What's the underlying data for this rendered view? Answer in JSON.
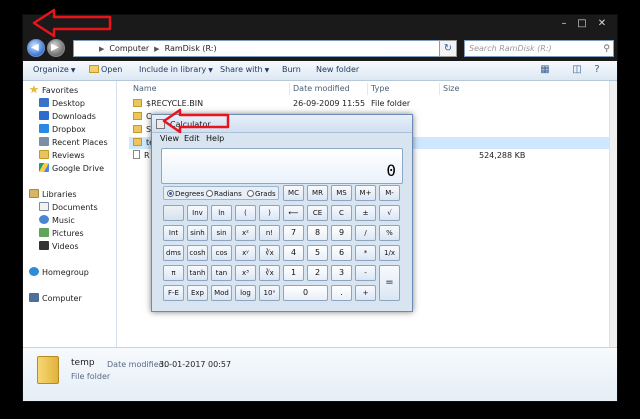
{
  "explorer": {
    "address_parts": [
      "Computer",
      "RamDisk (R:)"
    ],
    "search_placeholder": "Search RamDisk (R:)",
    "toolbar": {
      "organize": "Organize",
      "open": "Open",
      "include_in_library": "Include in library",
      "share_with": "Share with",
      "burn": "Burn",
      "new_folder": "New folder"
    },
    "nav": {
      "favorites": "Favorites",
      "favorites_items": [
        "Desktop",
        "Downloads",
        "Dropbox",
        "Recent Places",
        "Reviews",
        "Google Drive"
      ],
      "libraries": "Libraries",
      "libraries_items": [
        "Documents",
        "Music",
        "Pictures",
        "Videos"
      ],
      "homegroup": "Homegroup",
      "computer": "Computer"
    },
    "columns": {
      "name": "Name",
      "date_modified": "Date modified",
      "type": "Type",
      "size": "Size"
    },
    "rows": [
      {
        "name": "$RECYCLE.BIN",
        "date": "26-09-2009 11:55",
        "type": "File folder",
        "size": ""
      },
      {
        "name": "C",
        "date": "",
        "type": "",
        "size": ""
      },
      {
        "name": "S",
        "date": "",
        "type": "",
        "size": ""
      },
      {
        "name": "te",
        "date": "",
        "type": "",
        "size": ""
      },
      {
        "name": "R",
        "date": "",
        "type": "",
        "size": "524,288 KB"
      }
    ],
    "details": {
      "name": "temp",
      "modified_label": "Date modified:",
      "modified_value": "30-01-2017 00:57",
      "type": "File folder"
    }
  },
  "calculator": {
    "title": "Calculator",
    "menu": [
      "View",
      "Edit",
      "Help"
    ],
    "display": "0",
    "modes": [
      "Degrees",
      "Radians",
      "Grads"
    ],
    "selected_mode": "Degrees",
    "keys": {
      "mc": "MC",
      "mr": "MR",
      "ms": "MS",
      "mplus": "M+",
      "mminus": "M-",
      "inv": "Inv",
      "ln": "ln",
      "lparen": "(",
      "rparen": ")",
      "backspace": "⟵",
      "ce": "CE",
      "c": "C",
      "plusminus": "±",
      "sqrt": "√",
      "int": "Int",
      "sinh": "sinh",
      "sin": "sin",
      "xsq": "x²",
      "fact": "n!",
      "k7": "7",
      "k8": "8",
      "k9": "9",
      "div": "/",
      "pct": "%",
      "dms": "dms",
      "cosh": "cosh",
      "cos": "cos",
      "xy": "xʸ",
      "yroot": "∛x",
      "k4": "4",
      "k5": "5",
      "k6": "6",
      "mul": "*",
      "recip": "1/x",
      "pi": "π",
      "tanh": "tanh",
      "tan": "tan",
      "xcube": "x³",
      "cuberoot": "∛x",
      "k1": "1",
      "k2": "2",
      "k3": "3",
      "sub": "-",
      "eq": "=",
      "fe": "F-E",
      "exp": "Exp",
      "mod": "Mod",
      "log": "log",
      "tenx": "10ˣ",
      "k0": "0",
      "dot": ".",
      "add": "+"
    }
  },
  "colors": {
    "annotation_red": "#e8141c",
    "window_chrome": "#1a1a1a"
  }
}
